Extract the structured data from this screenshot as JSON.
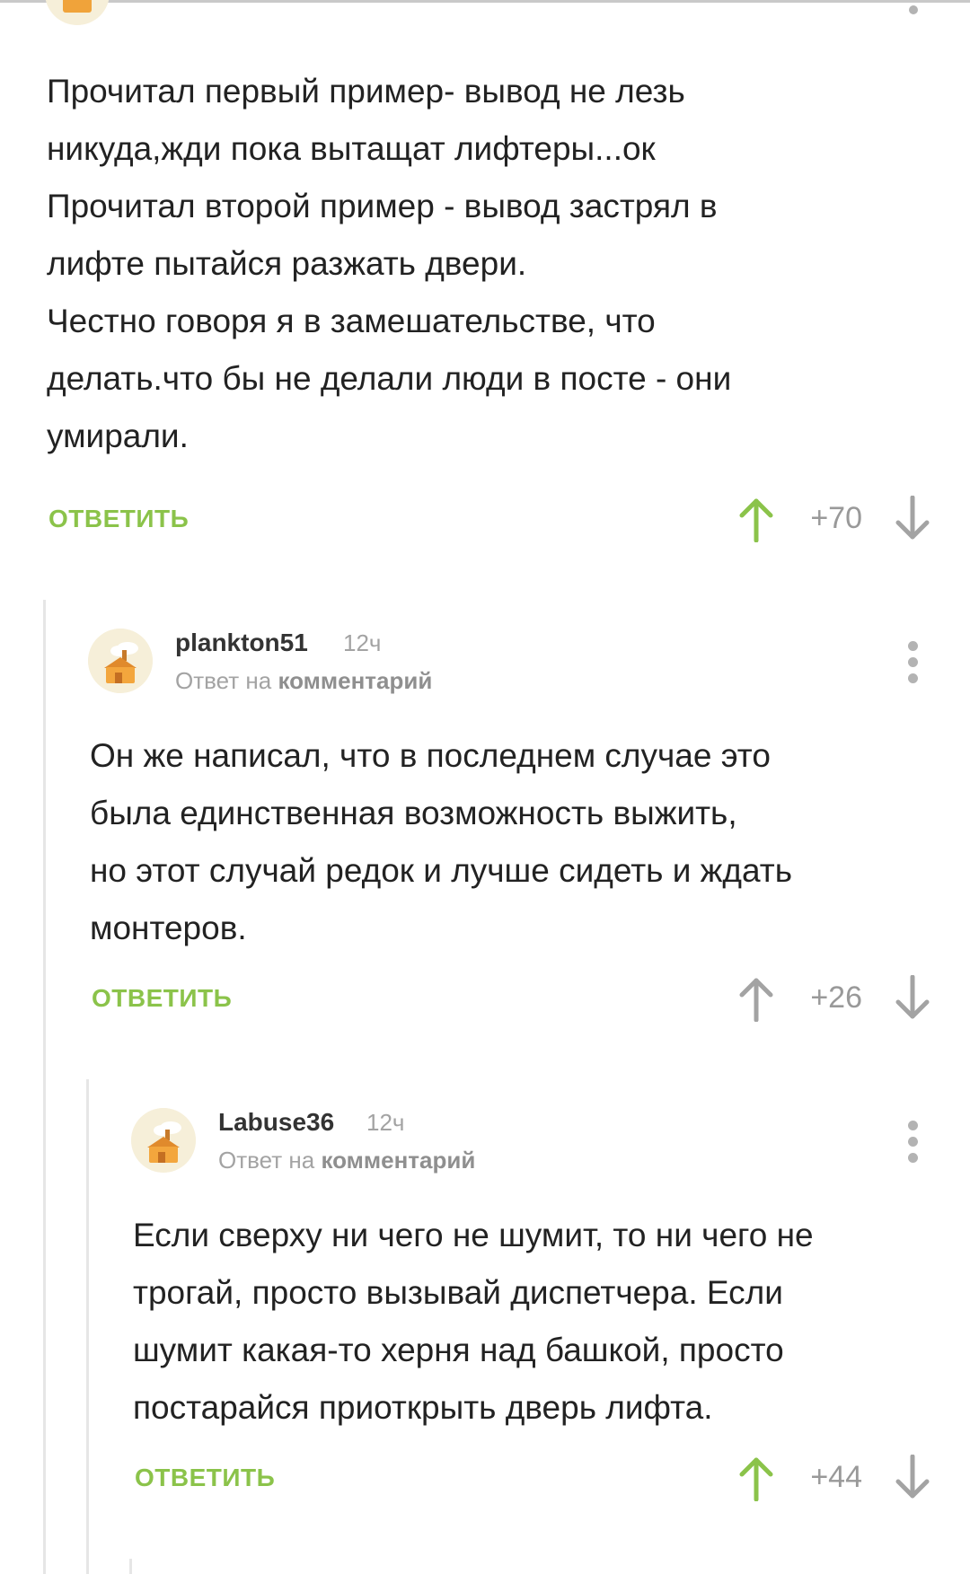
{
  "comments": [
    {
      "id": "c1",
      "text_lines": [
        "Прочитал первый пример- вывод не лезь",
        "никуда,жди пока вытащат лифтеры...ок",
        "Прочитал второй пример - вывод застрял в",
        "лифте пытайся разжать двери.",
        "Честно говоря я в замешательстве, что",
        "делать.что бы не делали люди в посте - они",
        "умирали."
      ],
      "reply_label": "ОТВЕТИТЬ",
      "score": "+70",
      "upvote_state": "active"
    },
    {
      "id": "c2",
      "username": "plankton51",
      "time": "12ч",
      "reply_prefix": "Ответ на",
      "reply_target": "комментарий",
      "text_lines": [
        "Он же написал, что в последнем случае это",
        "была единственная возможность выжить,",
        "но этот случай редок и лучше сидеть и ждать",
        "монтеров."
      ],
      "reply_label": "ОТВЕТИТЬ",
      "score": "+26",
      "upvote_state": "neutral"
    },
    {
      "id": "c3",
      "username": "Labuse36",
      "time": "12ч",
      "reply_prefix": "Ответ на",
      "reply_target": "комментарий",
      "text_lines": [
        "Если сверху ни чего не шумит, то ни чего не",
        "трогай, просто вызывай диспетчера. Если",
        "шумит какая-то херня над башкой, просто",
        "постарайся приоткрыть дверь лифта."
      ],
      "reply_label": "ОТВЕТИТЬ",
      "score": "+44",
      "upvote_state": "active"
    }
  ],
  "icons": {
    "upvote": "arrow-up-icon",
    "downvote": "arrow-down-icon",
    "more": "more-vertical-icon",
    "avatar": "default-avatar-icon"
  },
  "colors": {
    "accent_green": "#8bc34a",
    "upvote_active": "#8bc34a",
    "neutral_gray": "#a3a3a3",
    "thread_line": "#e6e6e6"
  }
}
